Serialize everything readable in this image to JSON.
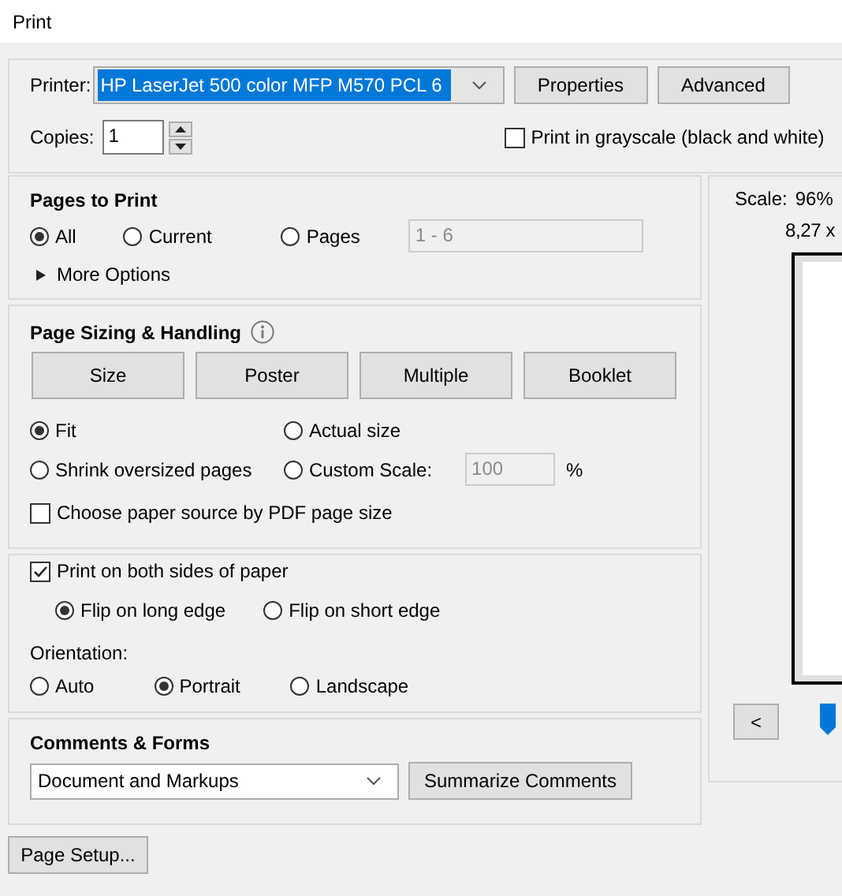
{
  "window": {
    "title": "Print"
  },
  "printer": {
    "label": "Printer:",
    "value": "HP LaserJet 500 color MFP M570 PCL 6",
    "buttons": [
      "Properties",
      "Advanced"
    ]
  },
  "copies": {
    "label": "Copies:",
    "value": "1"
  },
  "grayscale": {
    "label": "Print in grayscale (black and white)",
    "checked": false
  },
  "pages_to_print": {
    "title": "Pages to Print",
    "options": [
      {
        "label": "All",
        "selected": true
      },
      {
        "label": "Current",
        "selected": false
      },
      {
        "label": "Pages",
        "selected": false
      }
    ],
    "range": {
      "value": "1 - 6",
      "disabled": true
    },
    "more_options": {
      "label": "More Options",
      "expanded": false
    }
  },
  "page_sizing": {
    "title": "Page Sizing & Handling",
    "modes": [
      "Size",
      "Poster",
      "Multiple",
      "Booklet"
    ],
    "scale_options": [
      {
        "label": "Fit",
        "selected": true
      },
      {
        "label": "Actual size",
        "selected": false
      },
      {
        "label": "Shrink oversized pages",
        "selected": false
      },
      {
        "label": "Custom Scale:",
        "selected": false
      }
    ],
    "custom_scale": {
      "value": "100",
      "unit": "%",
      "disabled": true
    },
    "paper_source": {
      "label": "Choose paper source by PDF page size",
      "checked": false
    }
  },
  "duplex": {
    "label": "Print on both sides of paper",
    "checked": true,
    "options": [
      {
        "label": "Flip on long edge",
        "selected": true
      },
      {
        "label": "Flip on short edge",
        "selected": false
      }
    ]
  },
  "orientation": {
    "label": "Orientation:",
    "options": [
      {
        "label": "Auto",
        "selected": false
      },
      {
        "label": "Portrait",
        "selected": true
      },
      {
        "label": "Landscape",
        "selected": false
      }
    ]
  },
  "comments_forms": {
    "title": "Comments & Forms",
    "value": "Document and Markups",
    "button": "Summarize Comments"
  },
  "page_setup_button": "Page Setup...",
  "preview": {
    "scale_label": "Scale:",
    "scale_value": "96%",
    "page_size": "8,27 x",
    "back_button": "<"
  }
}
